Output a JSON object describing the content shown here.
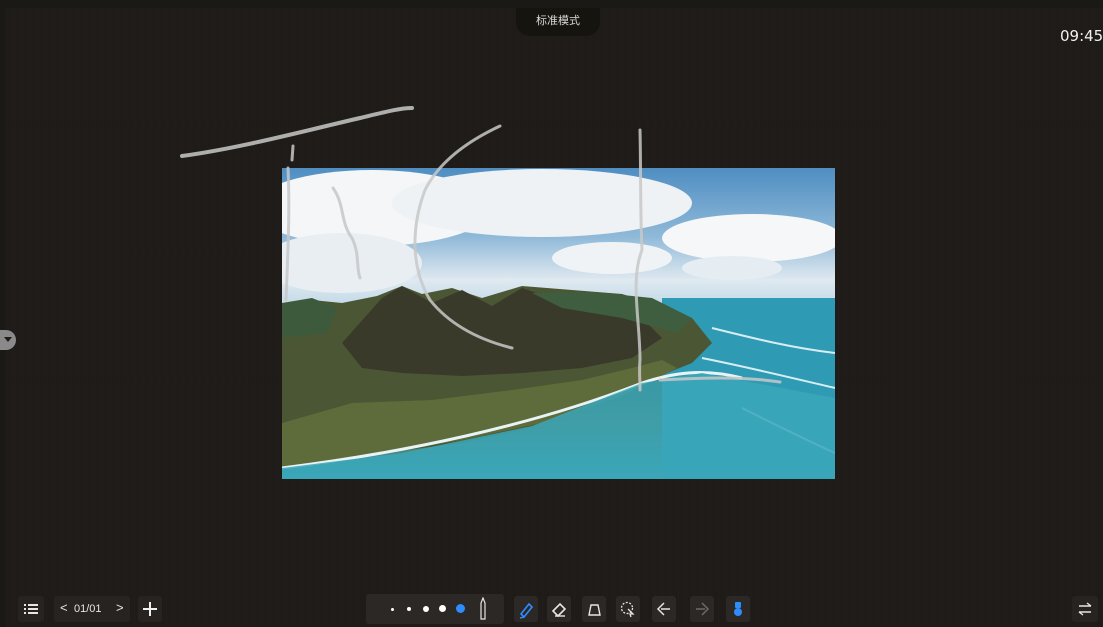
{
  "header": {
    "mode_tab_label": "标准模式",
    "clock": "09:45"
  },
  "page_nav": {
    "prev_glyph": "<",
    "page": "01/01",
    "next_glyph": ">"
  },
  "toolbar": {
    "menu_icon": "list-icon",
    "add_page_icon": "plus-icon",
    "pen_sizes": 5,
    "selected_pen_size_index": 4,
    "accent_color": "#2f8cff",
    "tools": [
      "pen-icon",
      "eraser-icon",
      "shape-icon",
      "lasso-select-icon",
      "undo-icon",
      "redo-icon",
      "touch-icon"
    ],
    "switch_icon": "switch-sides-icon"
  },
  "canvas": {
    "background": "#1e1b18",
    "ink_color": "#c8c8c8"
  }
}
